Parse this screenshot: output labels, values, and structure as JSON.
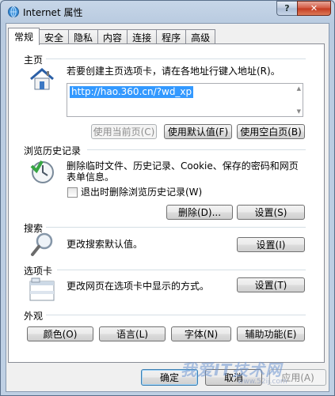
{
  "window": {
    "title": "Internet 属性",
    "help_label": "?",
    "close_label": "✕"
  },
  "tabs": [
    {
      "label": "常规",
      "active": true
    },
    {
      "label": "安全",
      "active": false
    },
    {
      "label": "隐私",
      "active": false
    },
    {
      "label": "内容",
      "active": false
    },
    {
      "label": "连接",
      "active": false
    },
    {
      "label": "程序",
      "active": false
    },
    {
      "label": "高级",
      "active": false
    }
  ],
  "homepage": {
    "title": "主页",
    "instruction": "若要创建主页选项卡，请在各地址行键入地址(R)。",
    "url": "http://hao.360.cn/?wd_xp",
    "use_current": "使用当前页(C)",
    "use_default": "使用默认值(F)",
    "use_blank": "使用空白页(B)"
  },
  "history": {
    "title": "浏览历史记录",
    "description_line1": "删除临时文件、历史记录、Cookie、保存的密码和网页",
    "description_line2": "表单信息。",
    "checkbox_label": "退出时删除浏览历史记录(W)",
    "checkbox_checked": false,
    "delete_button": "删除(D)...",
    "settings_button": "设置(S)"
  },
  "search": {
    "title": "搜索",
    "description": "更改搜索默认值。",
    "settings_button": "设置(I)"
  },
  "tabs_section": {
    "title": "选项卡",
    "description": "更改网页在选项卡中显示的方式。",
    "settings_button": "设置(T)"
  },
  "appearance": {
    "title": "外观",
    "colors_button": "颜色(O)",
    "languages_button": "语言(L)",
    "fonts_button": "字体(N)",
    "accessibility_button": "辅助功能(E)"
  },
  "footer": {
    "ok_button": "确定",
    "cancel_button": "取消",
    "apply_button": "应用(A)"
  },
  "watermark": {
    "text": "我爱IT技术网",
    "url": "www.52ij.com"
  },
  "colors": {
    "selection": "#3399ff",
    "frame": "#bfd0e4",
    "close": "#c33a20"
  }
}
